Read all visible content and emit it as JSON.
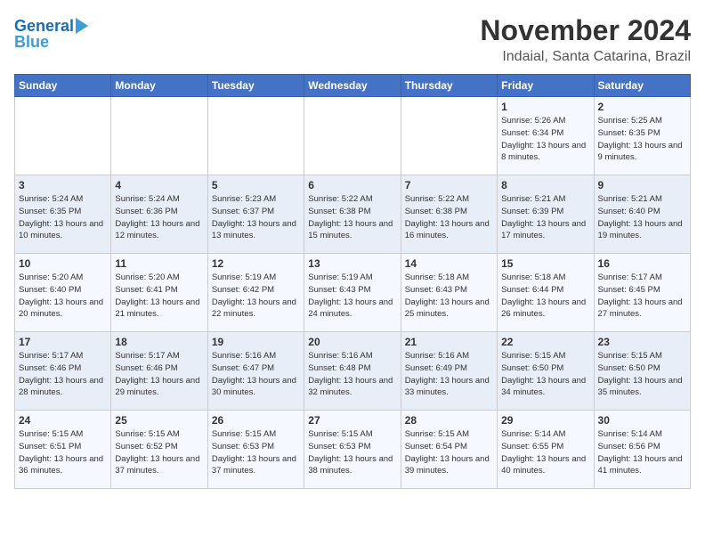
{
  "logo": {
    "line1": "General",
    "line2": "Blue"
  },
  "title": "November 2024",
  "location": "Indaial, Santa Catarina, Brazil",
  "days_of_week": [
    "Sunday",
    "Monday",
    "Tuesday",
    "Wednesday",
    "Thursday",
    "Friday",
    "Saturday"
  ],
  "weeks": [
    [
      {
        "day": "",
        "info": ""
      },
      {
        "day": "",
        "info": ""
      },
      {
        "day": "",
        "info": ""
      },
      {
        "day": "",
        "info": ""
      },
      {
        "day": "",
        "info": ""
      },
      {
        "day": "1",
        "info": "Sunrise: 5:26 AM\nSunset: 6:34 PM\nDaylight: 13 hours and 8 minutes."
      },
      {
        "day": "2",
        "info": "Sunrise: 5:25 AM\nSunset: 6:35 PM\nDaylight: 13 hours and 9 minutes."
      }
    ],
    [
      {
        "day": "3",
        "info": "Sunrise: 5:24 AM\nSunset: 6:35 PM\nDaylight: 13 hours and 10 minutes."
      },
      {
        "day": "4",
        "info": "Sunrise: 5:24 AM\nSunset: 6:36 PM\nDaylight: 13 hours and 12 minutes."
      },
      {
        "day": "5",
        "info": "Sunrise: 5:23 AM\nSunset: 6:37 PM\nDaylight: 13 hours and 13 minutes."
      },
      {
        "day": "6",
        "info": "Sunrise: 5:22 AM\nSunset: 6:38 PM\nDaylight: 13 hours and 15 minutes."
      },
      {
        "day": "7",
        "info": "Sunrise: 5:22 AM\nSunset: 6:38 PM\nDaylight: 13 hours and 16 minutes."
      },
      {
        "day": "8",
        "info": "Sunrise: 5:21 AM\nSunset: 6:39 PM\nDaylight: 13 hours and 17 minutes."
      },
      {
        "day": "9",
        "info": "Sunrise: 5:21 AM\nSunset: 6:40 PM\nDaylight: 13 hours and 19 minutes."
      }
    ],
    [
      {
        "day": "10",
        "info": "Sunrise: 5:20 AM\nSunset: 6:40 PM\nDaylight: 13 hours and 20 minutes."
      },
      {
        "day": "11",
        "info": "Sunrise: 5:20 AM\nSunset: 6:41 PM\nDaylight: 13 hours and 21 minutes."
      },
      {
        "day": "12",
        "info": "Sunrise: 5:19 AM\nSunset: 6:42 PM\nDaylight: 13 hours and 22 minutes."
      },
      {
        "day": "13",
        "info": "Sunrise: 5:19 AM\nSunset: 6:43 PM\nDaylight: 13 hours and 24 minutes."
      },
      {
        "day": "14",
        "info": "Sunrise: 5:18 AM\nSunset: 6:43 PM\nDaylight: 13 hours and 25 minutes."
      },
      {
        "day": "15",
        "info": "Sunrise: 5:18 AM\nSunset: 6:44 PM\nDaylight: 13 hours and 26 minutes."
      },
      {
        "day": "16",
        "info": "Sunrise: 5:17 AM\nSunset: 6:45 PM\nDaylight: 13 hours and 27 minutes."
      }
    ],
    [
      {
        "day": "17",
        "info": "Sunrise: 5:17 AM\nSunset: 6:46 PM\nDaylight: 13 hours and 28 minutes."
      },
      {
        "day": "18",
        "info": "Sunrise: 5:17 AM\nSunset: 6:46 PM\nDaylight: 13 hours and 29 minutes."
      },
      {
        "day": "19",
        "info": "Sunrise: 5:16 AM\nSunset: 6:47 PM\nDaylight: 13 hours and 30 minutes."
      },
      {
        "day": "20",
        "info": "Sunrise: 5:16 AM\nSunset: 6:48 PM\nDaylight: 13 hours and 32 minutes."
      },
      {
        "day": "21",
        "info": "Sunrise: 5:16 AM\nSunset: 6:49 PM\nDaylight: 13 hours and 33 minutes."
      },
      {
        "day": "22",
        "info": "Sunrise: 5:15 AM\nSunset: 6:50 PM\nDaylight: 13 hours and 34 minutes."
      },
      {
        "day": "23",
        "info": "Sunrise: 5:15 AM\nSunset: 6:50 PM\nDaylight: 13 hours and 35 minutes."
      }
    ],
    [
      {
        "day": "24",
        "info": "Sunrise: 5:15 AM\nSunset: 6:51 PM\nDaylight: 13 hours and 36 minutes."
      },
      {
        "day": "25",
        "info": "Sunrise: 5:15 AM\nSunset: 6:52 PM\nDaylight: 13 hours and 37 minutes."
      },
      {
        "day": "26",
        "info": "Sunrise: 5:15 AM\nSunset: 6:53 PM\nDaylight: 13 hours and 37 minutes."
      },
      {
        "day": "27",
        "info": "Sunrise: 5:15 AM\nSunset: 6:53 PM\nDaylight: 13 hours and 38 minutes."
      },
      {
        "day": "28",
        "info": "Sunrise: 5:15 AM\nSunset: 6:54 PM\nDaylight: 13 hours and 39 minutes."
      },
      {
        "day": "29",
        "info": "Sunrise: 5:14 AM\nSunset: 6:55 PM\nDaylight: 13 hours and 40 minutes."
      },
      {
        "day": "30",
        "info": "Sunrise: 5:14 AM\nSunset: 6:56 PM\nDaylight: 13 hours and 41 minutes."
      }
    ]
  ]
}
